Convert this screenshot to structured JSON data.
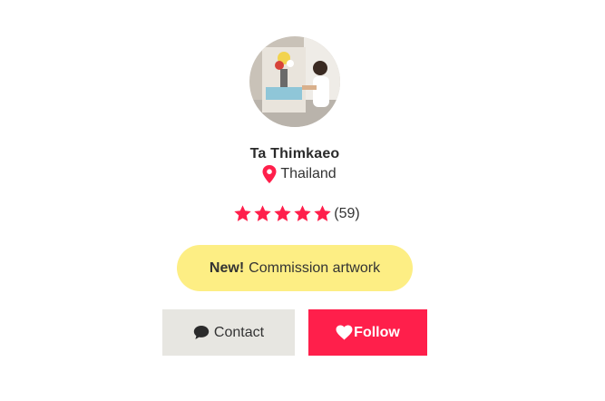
{
  "artist": {
    "name": "Ta Thimkaeo",
    "location": "Thailand",
    "avatar_icon": "artist-avatar-photo"
  },
  "rating": {
    "stars": 5,
    "max_stars": 5,
    "count_label": "(59)"
  },
  "commission": {
    "new_label": "New!",
    "label": "Commission artwork"
  },
  "actions": {
    "contact_label": "Contact",
    "follow_label": "Follow"
  },
  "colors": {
    "accent": "#ff1f4b",
    "commission_bg": "#fdee84",
    "contact_bg": "#e7e6e1"
  },
  "icons": {
    "location": "map-pin-icon",
    "star": "star-icon",
    "contact": "chat-bubble-icon",
    "follow": "heart-icon"
  }
}
